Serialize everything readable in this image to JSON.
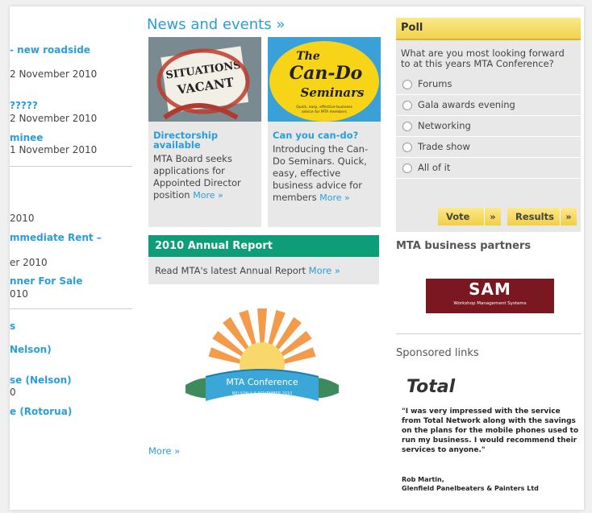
{
  "left": {
    "items": [
      {
        "title": "- new roadside",
        "date": "2 November 2010"
      },
      {
        "title": "?????",
        "date": "2 November 2010"
      },
      {
        "title": "minee",
        "date": "1 November 2010"
      }
    ],
    "date_only": "2010",
    "item_rent": {
      "title": "mmediate Rent –",
      "date": "er 2010"
    },
    "item_sale": {
      "title": "nner For Sale",
      "date": "010"
    },
    "nelson_header": "s",
    "links": [
      "Nelson)",
      "se (Nelson)",
      "e (Rotorua)"
    ],
    "link_digit": "0"
  },
  "news": {
    "title": "News and events »",
    "cards": [
      {
        "image_text": "SITUATIONS VACANT",
        "head": "Directorship available",
        "body": "MTA Board seeks applications for Appointed Director position",
        "more": "More »"
      },
      {
        "image_text_top": "The",
        "image_text_main": "Can-Do Seminars",
        "image_text_sub": "Quick, easy, effective business advice for MTA members",
        "head": "Can you can-do?",
        "body": "Introducing the Can-Do Seminars. Quick, easy, effective business advice for members",
        "more": "More »"
      }
    ],
    "annual_title": "2010 Annual Report",
    "annual_body": "Read MTA's latest Annual Report",
    "annual_more": "More »",
    "conference_label": "MTA Conference",
    "conference_sub": "NELSON 4-6 NOVEMBER 2010",
    "more": "More »"
  },
  "poll": {
    "title": "Poll",
    "question": "What are you most looking forward to at this years MTA Conference?",
    "options": [
      "Forums",
      "Gala awards evening",
      "Networking",
      "Trade show",
      "All of it"
    ],
    "vote_label": "Vote",
    "results_label": "Results",
    "arrow": "»"
  },
  "partners": {
    "title": "MTA business partners",
    "logo_main": "SAM",
    "logo_sub": "Workshop Management Systems"
  },
  "sponsored": {
    "title": "Sponsored links",
    "brand": "Total",
    "quote": "\"I was very impressed with the service from Total Network along with the savings on the plans for the mobile phones used to run my business. I would recommend their services to anyone.\"",
    "sig_name": "Rob Martin,",
    "sig_company": "Glenfield Panelbeaters & Painters Ltd"
  },
  "colors": {
    "link": "#2a9ed8",
    "annual": "#0d9d78",
    "poll_header": "#f1d34c",
    "sam": "#7a1721"
  }
}
